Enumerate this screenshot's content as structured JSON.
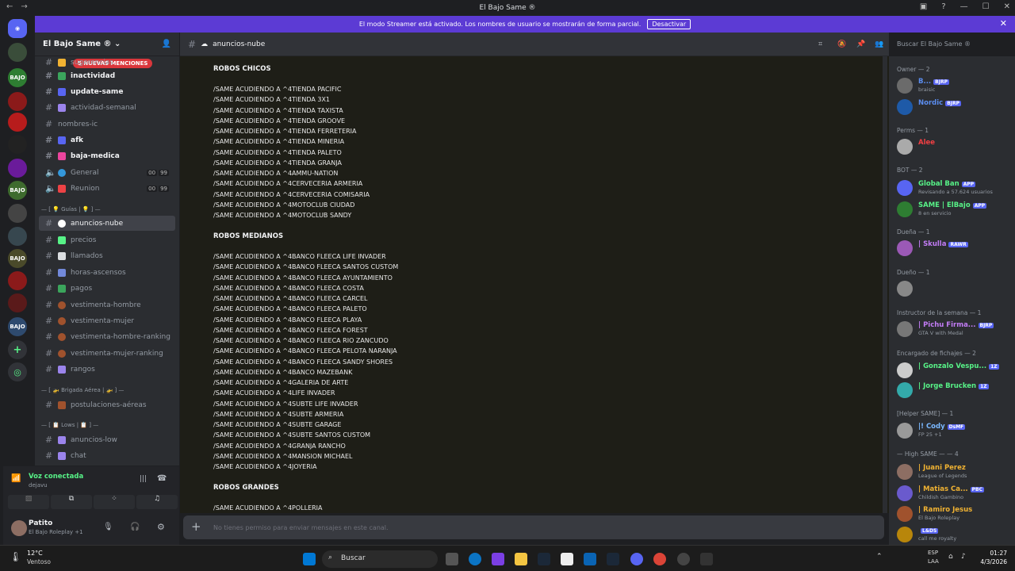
{
  "window": {
    "title": "El Bajo Same ®"
  },
  "banner": {
    "text": "El modo Streamer está activado. Los nombres de usuario se mostrarán de forma parcial.",
    "button": "Desactivar"
  },
  "server": {
    "name": "El Bajo Same ®",
    "mentions": "5 NUEVAS MENCIONES"
  },
  "channels": [
    {
      "label": "sugerencias"
    },
    {
      "label": "inactividad"
    },
    {
      "label": "update-same"
    },
    {
      "label": "actividad-semanal"
    },
    {
      "label": "nombres-ic"
    },
    {
      "label": "afk"
    },
    {
      "label": "baja-medica"
    },
    {
      "label": "General"
    },
    {
      "label": "Reunion"
    },
    {
      "label": "anuncios-nube"
    },
    {
      "label": "precios"
    },
    {
      "label": "llamados"
    },
    {
      "label": "horas-ascensos"
    },
    {
      "label": "pagos"
    },
    {
      "label": "vestimenta-hombre"
    },
    {
      "label": "vestimenta-mujer"
    },
    {
      "label": "vestimenta-hombre-ranking"
    },
    {
      "label": "vestimenta-mujer-ranking"
    },
    {
      "label": "rangos"
    },
    {
      "label": "postulaciones-aéreas"
    },
    {
      "label": "anuncios-low"
    },
    {
      "label": "chat"
    }
  ],
  "voice_counts": [
    {
      "a": "00",
      "b": "99"
    },
    {
      "a": "00",
      "b": "99"
    }
  ],
  "categories": {
    "guias": "— [ 💡 Guías | 💡 ] —",
    "brigada": "— [ 🚁 Brigada Aérea | 🚁 ] —",
    "lows": "— [ 📋 Lows | 📋 ] —"
  },
  "voice": {
    "status": "Voz conectada",
    "channel": "dejavu"
  },
  "user": {
    "name": "Patito",
    "status": "El Bajo Roleplay +1"
  },
  "header": {
    "channel": "anuncios-nube",
    "search_placeholder": "Buscar El Bajo Same ®"
  },
  "messages": {
    "h1": "ROBOS CHICOS",
    "chicos": [
      "/SAME ACUDIENDO A ^4TIENDA PACIFIC",
      "/SAME ACUDIENDO A ^4TIENDA 3X1",
      "/SAME ACUDIENDO A ^4TIENDA TAXISTA",
      "/SAME ACUDIENDO A ^4TIENDA GROOVE",
      "/SAME ACUDIENDO A ^4TIENDA FERRETERIA",
      "/SAME ACUDIENDO A ^4TIENDA MINERIA",
      "/SAME ACUDIENDO A ^4TIENDA PALETO",
      "/SAME ACUDIENDO A ^4TIENDA GRANJA",
      "/SAME ACUDIENDO A ^4AMMU-NATION",
      "/SAME ACUDIENDO A ^4CERVECERIA ARMERIA",
      "/SAME ACUDIENDO A ^4CERVECERIA COMISARIA",
      "/SAME ACUDIENDO A ^4MOTOCLUB CIUDAD",
      "/SAME ACUDIENDO A ^4MOTOCLUB SANDY"
    ],
    "h2": "ROBOS MEDIANOS",
    "medianos": [
      "/SAME ACUDIENDO A ^4BANCO FLEECA LIFE INVADER",
      "/SAME ACUDIENDO A ^4BANCO FLEECA SANTOS CUSTOM",
      "/SAME ACUDIENDO A ^4BANCO FLEECA AYUNTAMIENTO",
      "/SAME ACUDIENDO A ^4BANCO FLEECA COSTA",
      "/SAME ACUDIENDO A ^4BANCO FLEECA CARCEL",
      "/SAME ACUDIENDO A ^4BANCO FLEECA PALETO",
      "/SAME ACUDIENDO A ^4BANCO FLEECA PLAYA",
      "/SAME ACUDIENDO A ^4BANCO FLEECA FOREST",
      "/SAME ACUDIENDO A ^4BANCO FLEECA RIO ZANCUDO",
      "/SAME ACUDIENDO A ^4BANCO FLEECA PELOTA NARANJA",
      "/SAME ACUDIENDO A ^4BANCO FLEECA SANDY SHORES",
      "/SAME ACUDIENDO A ^4BANCO MAZEBANK",
      "/SAME ACUDIENDO A ^4GALERIA DE ARTE",
      "/SAME ACUDIENDO A ^4LIFE INVADER",
      "/SAME ACUDIENDO A ^4SUBTE LIFE INVADER",
      "/SAME ACUDIENDO A ^4SUBTE ARMERIA",
      "/SAME ACUDIENDO A ^4SUBTE GARAGE",
      "/SAME ACUDIENDO A ^4SUBTE SANTOS CUSTOM",
      "/SAME ACUDIENDO A ^4GRANJA RANCHO",
      "/SAME ACUDIENDO A ^4MANSION MICHAEL",
      "/SAME ACUDIENDO A ^4JOYERIA"
    ],
    "h3": "ROBOS GRANDES",
    "grandes": [
      "/SAME ACUDIENDO A ^4POLLERIA"
    ]
  },
  "composer": {
    "placeholder": "No tienes permiso para enviar mensajes en este canal."
  },
  "members": {
    "roles": [
      "Owner — 2",
      "Perms — 1",
      "BOT — 2",
      "Dueña — 1",
      "Dueño — 1",
      "Instructor de la semana — 1",
      "Encargado de fichajes — 2",
      "[Helper SAME] — 1",
      "— High SAME — — 4"
    ],
    "list": [
      {
        "name": "B...",
        "sub": "braisic",
        "tag": "BJRP",
        "color": "#5b8def"
      },
      {
        "name": "Nordic",
        "sub": "",
        "tag": "BJRP",
        "color": "#5b8def"
      },
      {
        "name": "Alee",
        "sub": "",
        "tag": "",
        "color": "#f23f43"
      },
      {
        "name": "Global Ban",
        "sub": "Revisando a 57.624 usuarios",
        "tag": "APP",
        "color": "#57f287"
      },
      {
        "name": "SAME | ElBajo",
        "sub": "8 en servicio",
        "tag": "APP",
        "color": "#57f287"
      },
      {
        "name": "| Skulla",
        "sub": "",
        "tag": "RAWR",
        "color": "#c27cf5"
      },
      {
        "name": "",
        "sub": "",
        "tag": "",
        "color": "#c27cf5"
      },
      {
        "name": "| Pichu Firma...",
        "sub": "GTA V with Medal",
        "tag": "BJRP",
        "color": "#c27cf5"
      },
      {
        "name": "| Gonzalo Vespu...",
        "sub": "",
        "tag": "1Z",
        "color": "#57f287"
      },
      {
        "name": "| Jorge Brucken",
        "sub": "",
        "tag": "1Z",
        "color": "#57f287"
      },
      {
        "name": "|! Cody",
        "sub": "FP 25 +1",
        "tag": "DsMF",
        "color": "#7ab8ff"
      },
      {
        "name": "| Juani Perez",
        "sub": "League of Legends",
        "tag": "",
        "color": "#f0b232"
      },
      {
        "name": "| Matias Ca...",
        "sub": "Childish Gambino",
        "tag": "PBC",
        "color": "#f0b232"
      },
      {
        "name": "| Ramiro Jesus",
        "sub": "El Bajo Roleplay",
        "tag": "",
        "color": "#f0b232"
      },
      {
        "name": "",
        "sub": "call me royalty",
        "tag": "L&DS",
        "color": "#f0b232"
      }
    ]
  },
  "taskbar": {
    "weather_temp": "12°C",
    "weather_desc": "Ventoso",
    "search": "Buscar",
    "lang1": "ESP",
    "lang2": "LAA",
    "time": "01:27",
    "date": "4/3/2026"
  }
}
